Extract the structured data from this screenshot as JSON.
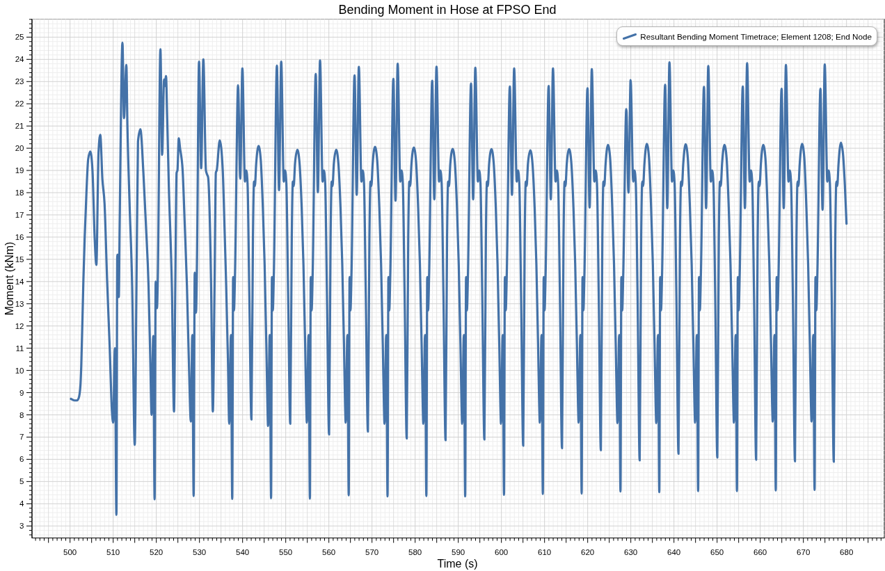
{
  "plot": {
    "chart_data": {
      "type": "line",
      "title": "Bending Moment in Hose at FPSO End",
      "xlabel": "Time (s)",
      "ylabel": "Moment (kNm)",
      "grid": true,
      "xlim": [
        491.18,
        688.76
      ],
      "ylim": [
        2.46,
        25.81
      ],
      "xticks": [
        500,
        510,
        520,
        530,
        540,
        550,
        560,
        570,
        580,
        590,
        600,
        610,
        620,
        630,
        640,
        650,
        660,
        670,
        680
      ],
      "yticks": [
        3,
        4,
        5,
        6,
        7,
        8,
        9,
        10,
        11,
        12,
        13,
        14,
        15,
        16,
        17,
        18,
        19,
        20,
        21,
        22,
        23,
        24,
        25
      ],
      "x": [
        500.2,
        500.6,
        501.0,
        501.6,
        502.0,
        502.4,
        502.6,
        503.1,
        503.4,
        503.8,
        504.2,
        504.7,
        505.2,
        505.7,
        506.1,
        506.6,
        507.0,
        507.5,
        508.0,
        508.6,
        509.2,
        509.7,
        510.0,
        510.4,
        510.75,
        510.95,
        511.2,
        511.3,
        511.5,
        512.15,
        512.5,
        513.05,
        513.3,
        513.8,
        514.4,
        515.0,
        515.4,
        515.75,
        516.3,
        517.0,
        517.6,
        518.2,
        518.6,
        518.9,
        519.3,
        519.6,
        519.85,
        520.15,
        520.35,
        520.95,
        521.35,
        521.8,
        522.0,
        522.25,
        522.5,
        522.9,
        523.6,
        524.1,
        524.4,
        524.7,
        524.9,
        525.2,
        525.5,
        526.1,
        526.6,
        527.1,
        527.6,
        528.0,
        528.35,
        528.65,
        528.9,
        529.2,
        529.4,
        529.9,
        530.4,
        530.9,
        531.5,
        531.8,
        532.0,
        532.7,
        533.1,
        533.5,
        533.8,
        534.0,
        534.7,
        535.4,
        535.8,
        536.2,
        536.6,
        536.9,
        537.3,
        537.6,
        537.8,
        538,
        538.25,
        538.95,
        539.45,
        539.95,
        540.55,
        540.85,
        541.15,
        541.55,
        542.05,
        542.4,
        542.65,
        542.85,
        543.15,
        543.7,
        544.2,
        544.7,
        545.1,
        545.5,
        545.75,
        545.9,
        546.3,
        546.6,
        546.8,
        547,
        547.25,
        547.95,
        548.45,
        548.95,
        549.55,
        549.85,
        550.15,
        550.55,
        551.05,
        551.4,
        551.65,
        551.85,
        552.15,
        552.7,
        553.2,
        553.7,
        554.1,
        554.5,
        554.75,
        554.9,
        555.3,
        555.6,
        555.8,
        556,
        556.25,
        556.95,
        557.45,
        557.95,
        558.55,
        558.85,
        559.15,
        559.55,
        560.05,
        560.4,
        560.65,
        560.85,
        561.15,
        561.7,
        562.2,
        562.7,
        563.1,
        563.5,
        563.75,
        563.9,
        564.3,
        564.6,
        564.8,
        565,
        565.25,
        565.95,
        566.45,
        566.95,
        567.55,
        567.85,
        568.15,
        568.55,
        569.05,
        569.4,
        569.65,
        569.85,
        570.15,
        570.7,
        571.2,
        571.7,
        572.1,
        572.5,
        572.75,
        572.9,
        573.3,
        573.6,
        573.8,
        574,
        574.25,
        574.95,
        575.45,
        575.95,
        576.55,
        576.85,
        577.15,
        577.55,
        578.05,
        578.4,
        578.65,
        578.85,
        579.15,
        579.7,
        580.2,
        580.7,
        581.1,
        581.5,
        581.75,
        581.9,
        582.3,
        582.6,
        582.8,
        583,
        583.25,
        583.95,
        584.45,
        584.95,
        585.55,
        585.85,
        586.15,
        586.55,
        587.05,
        587.4,
        587.65,
        587.85,
        588.15,
        588.7,
        589.2,
        589.7,
        590.1,
        590.5,
        590.75,
        590.9,
        591.3,
        591.6,
        591.8,
        592,
        592.25,
        592.95,
        593.45,
        593.95,
        594.55,
        594.85,
        595.15,
        595.55,
        596.05,
        596.4,
        596.65,
        596.85,
        597.15,
        597.7,
        598.2,
        598.7,
        599.1,
        599.5,
        599.75,
        599.9,
        600.3,
        600.6,
        600.8,
        601,
        601.25,
        601.95,
        602.45,
        602.95,
        603.55,
        603.85,
        604.15,
        604.55,
        605.05,
        605.4,
        605.65,
        605.85,
        606.15,
        606.7,
        607.2,
        607.7,
        608.1,
        608.5,
        608.75,
        608.9,
        609.3,
        609.6,
        609.8,
        610,
        610.25,
        610.95,
        611.45,
        611.95,
        612.55,
        612.85,
        613.15,
        613.55,
        614.05,
        614.4,
        614.65,
        614.85,
        615.15,
        615.7,
        616.2,
        616.7,
        617.1,
        617.5,
        617.75,
        617.9,
        618.3,
        618.6,
        618.8,
        619,
        619.25,
        619.95,
        620.45,
        620.95,
        621.55,
        621.85,
        622.15,
        622.55,
        623.05,
        623.4,
        623.65,
        623.85,
        624.15,
        624.7,
        625.2,
        625.7,
        626.1,
        626.5,
        626.75,
        626.9,
        627.3,
        627.6,
        627.8,
        628,
        628.25,
        628.95,
        629.45,
        629.95,
        630.55,
        630.85,
        631.15,
        631.55,
        632.05,
        632.4,
        632.65,
        632.85,
        633.15,
        633.7,
        634.2,
        634.7,
        635.1,
        635.5,
        635.75,
        635.9,
        636.3,
        636.6,
        636.8,
        637,
        637.25,
        637.95,
        638.45,
        638.95,
        639.55,
        639.85,
        640.15,
        640.55,
        641.05,
        641.4,
        641.65,
        641.85,
        642.15,
        642.7,
        643.2,
        643.7,
        644.1,
        644.5,
        644.75,
        644.9,
        645.3,
        645.6,
        645.8,
        646,
        646.25,
        646.95,
        647.45,
        647.95,
        648.55,
        648.85,
        649.15,
        649.55,
        650.05,
        650.4,
        650.65,
        650.85,
        651.15,
        651.7,
        652.2,
        652.7,
        653.1,
        653.5,
        653.75,
        653.9,
        654.3,
        654.6,
        654.8,
        655,
        655.25,
        655.95,
        656.45,
        656.95,
        657.55,
        657.85,
        658.15,
        658.55,
        659.05,
        659.4,
        659.65,
        659.85,
        660.15,
        660.7,
        661.2,
        661.7,
        662.1,
        662.5,
        662.75,
        662.9,
        663.3,
        663.6,
        663.8,
        664,
        664.25,
        664.95,
        665.45,
        665.95,
        666.55,
        666.85,
        667.15,
        667.55,
        668.05,
        668.4,
        668.65,
        668.85,
        669.15,
        669.7,
        670.2,
        670.7,
        671.1,
        671.5,
        671.75,
        671.9,
        672.3,
        672.6,
        672.8,
        673,
        673.25,
        673.95,
        674.45,
        674.95,
        675.55,
        675.85,
        676.15,
        676.55,
        677.05,
        677.4,
        677.65,
        677.85,
        678.15,
        678.7,
        679.2,
        679.6,
        680
      ],
      "series": [
        {
          "name": "Resultant Bending Moment Timetrace; Element 1208; End Node",
          "color": "#4472a8",
          "values": [
            8.72,
            8.68,
            8.65,
            8.65,
            8.75,
            9.3,
            10.2,
            14.1,
            16.0,
            18.0,
            19.5,
            19.85,
            19.0,
            16.0,
            14.75,
            19.8,
            20.6,
            18.6,
            17.5,
            14.0,
            11.0,
            8.2,
            7.65,
            11.0,
            3.5,
            15.2,
            15.2,
            13.3,
            16.5,
            24.75,
            21.35,
            23.75,
            21.0,
            17.5,
            13.8,
            6.65,
            13.8,
            20.3,
            20.85,
            18.9,
            16.5,
            13.8,
            10.5,
            8.0,
            11.55,
            4.2,
            14.0,
            12.8,
            14.2,
            24.45,
            19.7,
            23.1,
            22.8,
            23.25,
            21.5,
            18.3,
            13.8,
            8.15,
            13.8,
            18.9,
            19.0,
            20.45,
            20.0,
            19.0,
            16.5,
            13.8,
            10.0,
            7.7,
            11.6,
            4.35,
            14.4,
            12.6,
            14.5,
            23.9,
            19.1,
            24.0,
            19.0,
            18.8,
            18.7,
            13.8,
            8.15,
            13.8,
            18.9,
            19.0,
            20.35,
            19.0,
            16.5,
            13.8,
            10.5,
            7.6,
            11.6,
            4.22,
            14.2,
            12.7,
            14.4,
            22.83,
            18.63,
            23.59,
            18.5,
            19,
            18.4,
            13.5,
            7.79,
            16,
            18.5,
            18.3,
            19.3,
            20.1,
            19.5,
            17.3,
            14.8,
            11.2,
            8.5,
            7.5,
            11.6,
            4.25,
            14.2,
            12.7,
            14.4,
            23.72,
            18.11,
            23.9,
            18.5,
            19,
            18.4,
            13.5,
            7.6,
            16,
            18.5,
            18.3,
            19.3,
            19.93,
            19.33,
            17.3,
            14.8,
            11.2,
            8.5,
            7.65,
            11.6,
            4.23,
            14.2,
            12.7,
            14.4,
            23.34,
            18.02,
            23.95,
            18.5,
            19,
            18.4,
            13.5,
            7.12,
            16,
            18.5,
            18.3,
            19.3,
            19.93,
            19.33,
            17.3,
            14.8,
            11.2,
            8.5,
            7.65,
            11.6,
            4.38,
            14.2,
            12.7,
            14.4,
            23.28,
            17.9,
            23.66,
            18.5,
            19,
            18.4,
            13.5,
            7.25,
            16,
            18.5,
            18.3,
            19.3,
            20.06,
            19.46,
            17.3,
            14.8,
            11.2,
            8.5,
            7.6,
            11.6,
            4.33,
            14.2,
            12.7,
            14.4,
            23.12,
            17.64,
            23.8,
            18.5,
            19,
            18.4,
            13.5,
            6.94,
            16,
            18.5,
            18.3,
            19.3,
            20.03,
            19.43,
            17.3,
            14.8,
            11.2,
            8.5,
            7.6,
            11.6,
            4.35,
            14.2,
            12.7,
            14.4,
            23.04,
            17.7,
            23.67,
            18.5,
            19,
            18.4,
            13.5,
            6.86,
            16,
            18.5,
            18.3,
            19.3,
            19.97,
            19.37,
            17.3,
            14.8,
            11.2,
            8.5,
            7.6,
            11.6,
            4.33,
            14.2,
            12.7,
            14.4,
            22.91,
            17.7,
            23.62,
            18.5,
            19,
            18.4,
            13.5,
            6.89,
            16,
            18.5,
            18.3,
            19.3,
            19.96,
            19.36,
            17.3,
            14.8,
            11.2,
            8.5,
            7.6,
            11.6,
            4.4,
            14.2,
            12.7,
            14.4,
            22.78,
            17.9,
            23.59,
            18.5,
            19,
            18.4,
            13.5,
            6.61,
            16,
            18.5,
            18.3,
            19.3,
            19.91,
            19.31,
            17.3,
            14.8,
            11.2,
            8.5,
            7.65,
            11.6,
            4.44,
            14.2,
            12.7,
            14.4,
            22.8,
            17.7,
            23.59,
            18.5,
            19,
            18.4,
            13.5,
            6.5,
            16,
            18.5,
            18.3,
            19.3,
            19.96,
            19.36,
            17.3,
            14.8,
            11.2,
            8.5,
            7.65,
            11.6,
            4.46,
            14.2,
            12.7,
            14.4,
            22.7,
            17.33,
            23.56,
            18.5,
            19,
            18.4,
            13.5,
            6.41,
            16,
            18.5,
            18.3,
            19.3,
            20.15,
            19.55,
            17.3,
            14.8,
            11.2,
            8.5,
            7.63,
            11.6,
            4.55,
            14.2,
            12.7,
            14.4,
            21.76,
            18,
            23.07,
            18.5,
            19,
            18.4,
            13.5,
            5.95,
            16,
            18.5,
            18.3,
            19.3,
            20.2,
            19.6,
            17.3,
            14.8,
            11.2,
            8.5,
            7.63,
            11.6,
            4.52,
            14.2,
            12.7,
            14.4,
            22.86,
            17.3,
            23.87,
            18.5,
            19,
            18.4,
            13.5,
            6.25,
            16,
            18.5,
            18.3,
            19.3,
            20.18,
            19.58,
            17.3,
            14.8,
            11.2,
            8.5,
            7.65,
            11.6,
            4.57,
            14.2,
            12.7,
            14.4,
            22.76,
            17.3,
            23.7,
            18.5,
            19,
            18.4,
            13.5,
            6.08,
            16,
            18.5,
            18.3,
            19.3,
            20.15,
            19.55,
            17.3,
            14.8,
            11.2,
            8.5,
            7.65,
            11.6,
            4.57,
            14.2,
            12.7,
            14.4,
            22.78,
            17.3,
            23.83,
            18.5,
            19,
            18.4,
            13.5,
            5.98,
            16,
            18.5,
            18.3,
            19.3,
            20.15,
            19.55,
            17.3,
            14.8,
            11.2,
            8.5,
            7.7,
            11.6,
            4.6,
            14.2,
            12.7,
            14.4,
            22.68,
            17.3,
            23.75,
            18.5,
            19,
            18.4,
            13.5,
            5.91,
            16,
            18.5,
            18.3,
            19.3,
            20.2,
            19.6,
            17.3,
            14.8,
            11.2,
            8.5,
            7.7,
            11.6,
            4.62,
            14.2,
            12.7,
            14.4,
            22.68,
            17.23,
            23.77,
            18.5,
            19,
            18.4,
            13.5,
            5.89,
            16,
            18.5,
            18.3,
            19.3,
            20.25,
            19.7,
            18.4,
            16.6
          ]
        }
      ]
    }
  }
}
